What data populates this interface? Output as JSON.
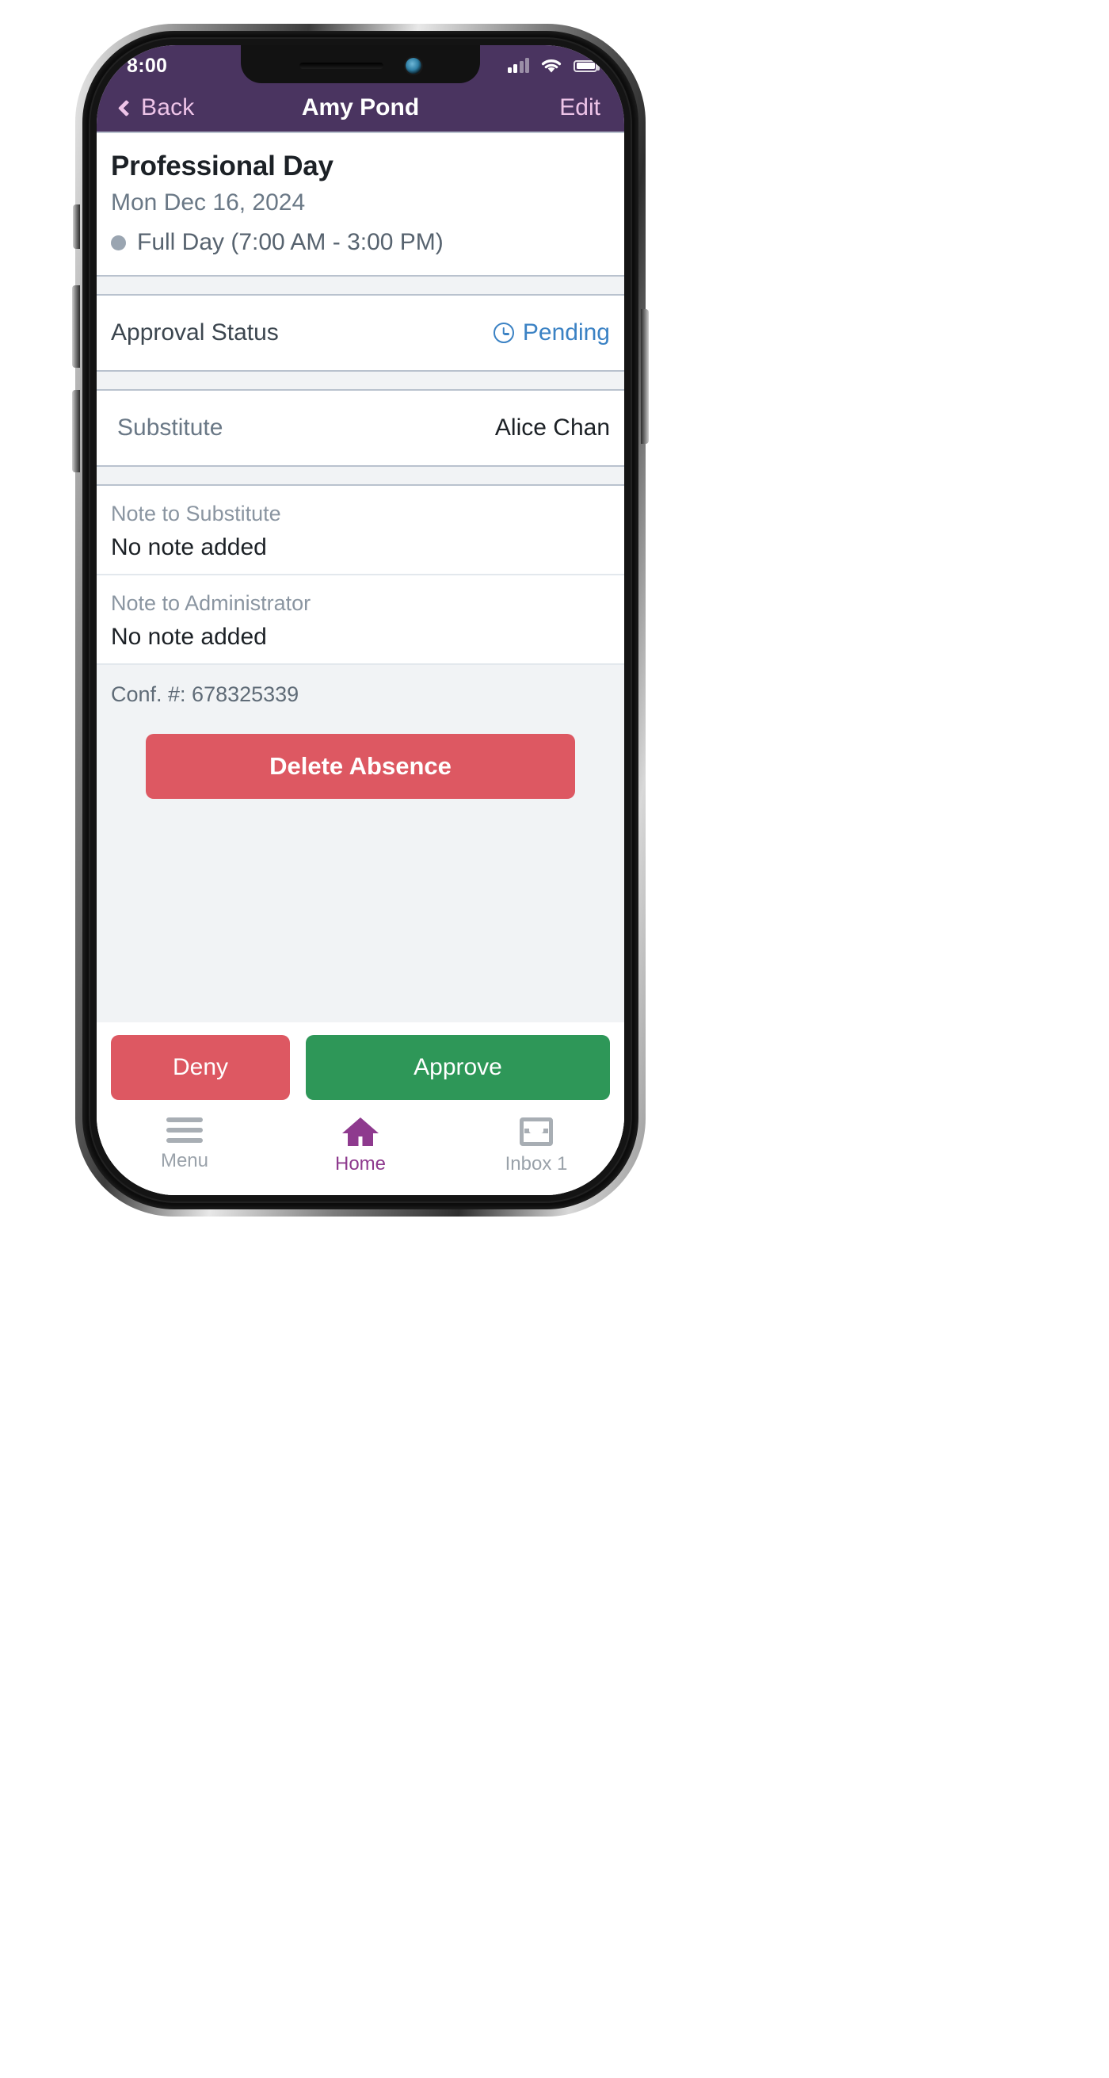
{
  "status_bar": {
    "time": "8:00",
    "cellular_icon": "cellular-signal-icon",
    "wifi_icon": "wifi-icon",
    "battery_icon": "battery-full-icon"
  },
  "nav_bar": {
    "back_label": "Back",
    "back_icon": "chevron-left-icon",
    "title": "Amy Pond",
    "edit_label": "Edit"
  },
  "absence": {
    "title": "Professional Day",
    "date": "Mon Dec 16, 2024",
    "duration": "Full Day (7:00 AM - 3:00 PM)"
  },
  "approval": {
    "label": "Approval Status",
    "value": "Pending",
    "icon": "clock-icon"
  },
  "substitute": {
    "label": "Substitute",
    "value": "Alice Chan"
  },
  "notes": [
    {
      "label": "Note to Substitute",
      "value": "No note added"
    },
    {
      "label": "Note to Administrator",
      "value": "No note added"
    }
  ],
  "confirmation": {
    "text": "Conf. #: 678325339",
    "delete_label": "Delete Absence"
  },
  "actions": {
    "deny_label": "Deny",
    "approve_label": "Approve"
  },
  "tab_bar": {
    "menu_label": "Menu",
    "menu_icon": "hamburger-menu-icon",
    "home_label": "Home",
    "home_icon": "home-icon",
    "inbox_label": "Inbox 1",
    "inbox_icon": "inbox-tray-icon"
  },
  "colors": {
    "header_purple": "#4a3460",
    "accent_pink": "#eec4e8",
    "pending_blue": "#3b82c4",
    "danger_red": "#dd5862",
    "success_green": "#2e9758",
    "active_tab_purple": "#8e3a8e"
  }
}
